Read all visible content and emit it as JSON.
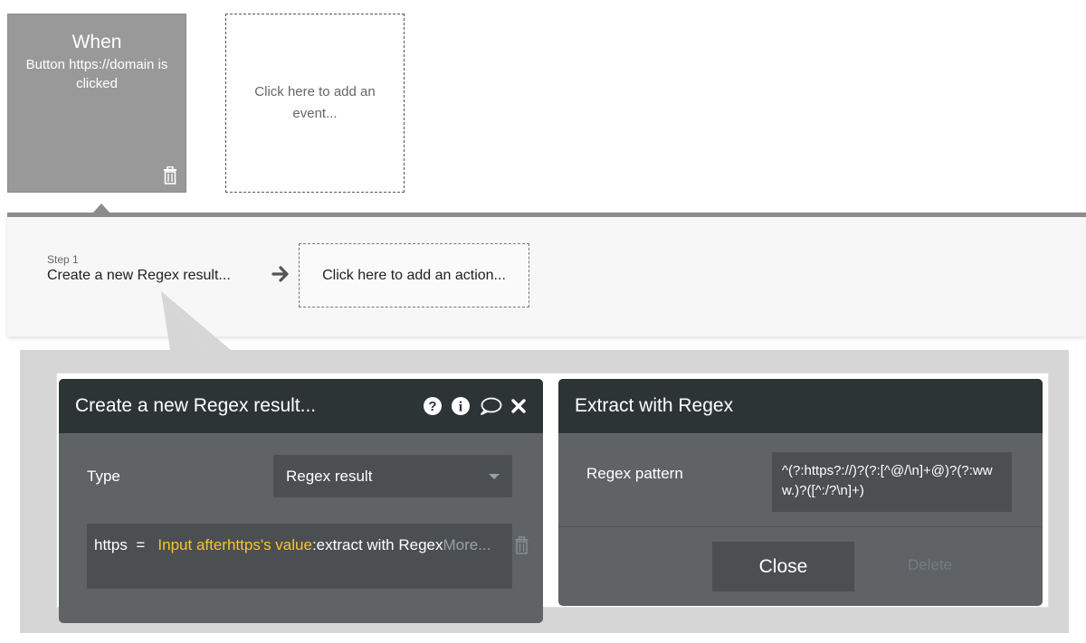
{
  "event": {
    "when_label": "When",
    "description": "Button https://domain is clicked",
    "add_event_label": "Click here to add an event..."
  },
  "workflow": {
    "step_label": "Step 1",
    "step_title": "Create a new Regex result...",
    "add_action_label": "Click here to add an action..."
  },
  "action_panel": {
    "title": "Create a new Regex result...",
    "icons": [
      "question-icon",
      "info-icon",
      "comment-icon",
      "close-icon"
    ],
    "type_label": "Type",
    "type_value": "Regex result",
    "expression": {
      "field": "https",
      "equals": "=",
      "dynamic": "Input afterhttps's value",
      "operator": ":extract with",
      "suffix": "Regex",
      "more": "More..."
    }
  },
  "regex_panel": {
    "title": "Extract with Regex",
    "pattern_label": "Regex pattern",
    "pattern_value": "^(?:https?://)?(?:[^@/\\n]+@)?(?:www.)?([^:/?\\n]+)",
    "close_label": "Close",
    "delete_label": "Delete"
  },
  "colors": {
    "header_bg": "#2d3436",
    "panel_bg": "#5f6366",
    "field_bg": "#4b4f52",
    "dynamic_text": "#f7c531",
    "event_card_bg": "#999999"
  }
}
